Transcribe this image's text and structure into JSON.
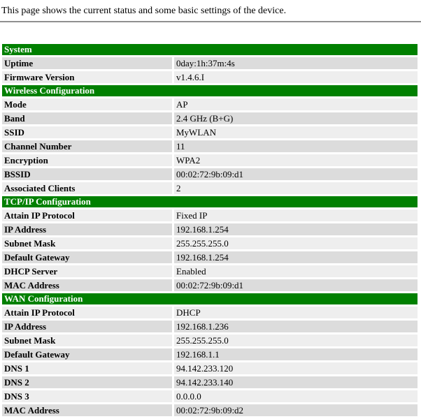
{
  "page": {
    "description": "This page shows the current status and some basic settings of the device."
  },
  "colors": {
    "page_bg": "#ffffff",
    "text_color": "#000000",
    "rule_color": "#909090",
    "header_bg": "#008000",
    "header_text": "#ffffff",
    "row_dark": "#dcdcdc",
    "row_light": "#eeeeee"
  },
  "sections": [
    {
      "title": "System",
      "rows": [
        {
          "label": "Uptime",
          "value": "0day:1h:37m:4s"
        },
        {
          "label": "Firmware Version",
          "value": "v1.4.6.I"
        }
      ]
    },
    {
      "title": "Wireless Configuration",
      "rows": [
        {
          "label": "Mode",
          "value": "AP"
        },
        {
          "label": "Band",
          "value": "2.4 GHz (B+G)"
        },
        {
          "label": "SSID",
          "value": "MyWLAN"
        },
        {
          "label": "Channel Number",
          "value": "11"
        },
        {
          "label": "Encryption",
          "value": "WPA2"
        },
        {
          "label": "BSSID",
          "value": "00:02:72:9b:09:d1"
        },
        {
          "label": "Associated Clients",
          "value": "2"
        }
      ]
    },
    {
      "title": "TCP/IP Configuration",
      "rows": [
        {
          "label": "Attain IP Protocol",
          "value": "Fixed IP"
        },
        {
          "label": "IP Address",
          "value": "192.168.1.254"
        },
        {
          "label": "Subnet Mask",
          "value": "255.255.255.0"
        },
        {
          "label": "Default Gateway",
          "value": "192.168.1.254"
        },
        {
          "label": "DHCP Server",
          "value": "Enabled"
        },
        {
          "label": "MAC Address",
          "value": "00:02:72:9b:09:d1"
        }
      ]
    },
    {
      "title": "WAN Configuration",
      "rows": [
        {
          "label": "Attain IP Protocol",
          "value": "DHCP"
        },
        {
          "label": "IP Address",
          "value": "192.168.1.236"
        },
        {
          "label": "Subnet Mask",
          "value": "255.255.255.0"
        },
        {
          "label": "Default Gateway",
          "value": "192.168.1.1"
        },
        {
          "label": "DNS 1",
          "value": "94.142.233.120"
        },
        {
          "label": "DNS 2",
          "value": "94.142.233.140"
        },
        {
          "label": "DNS 3",
          "value": "0.0.0.0"
        },
        {
          "label": "MAC Address",
          "value": "00:02:72:9b:09:d2"
        }
      ]
    }
  ]
}
